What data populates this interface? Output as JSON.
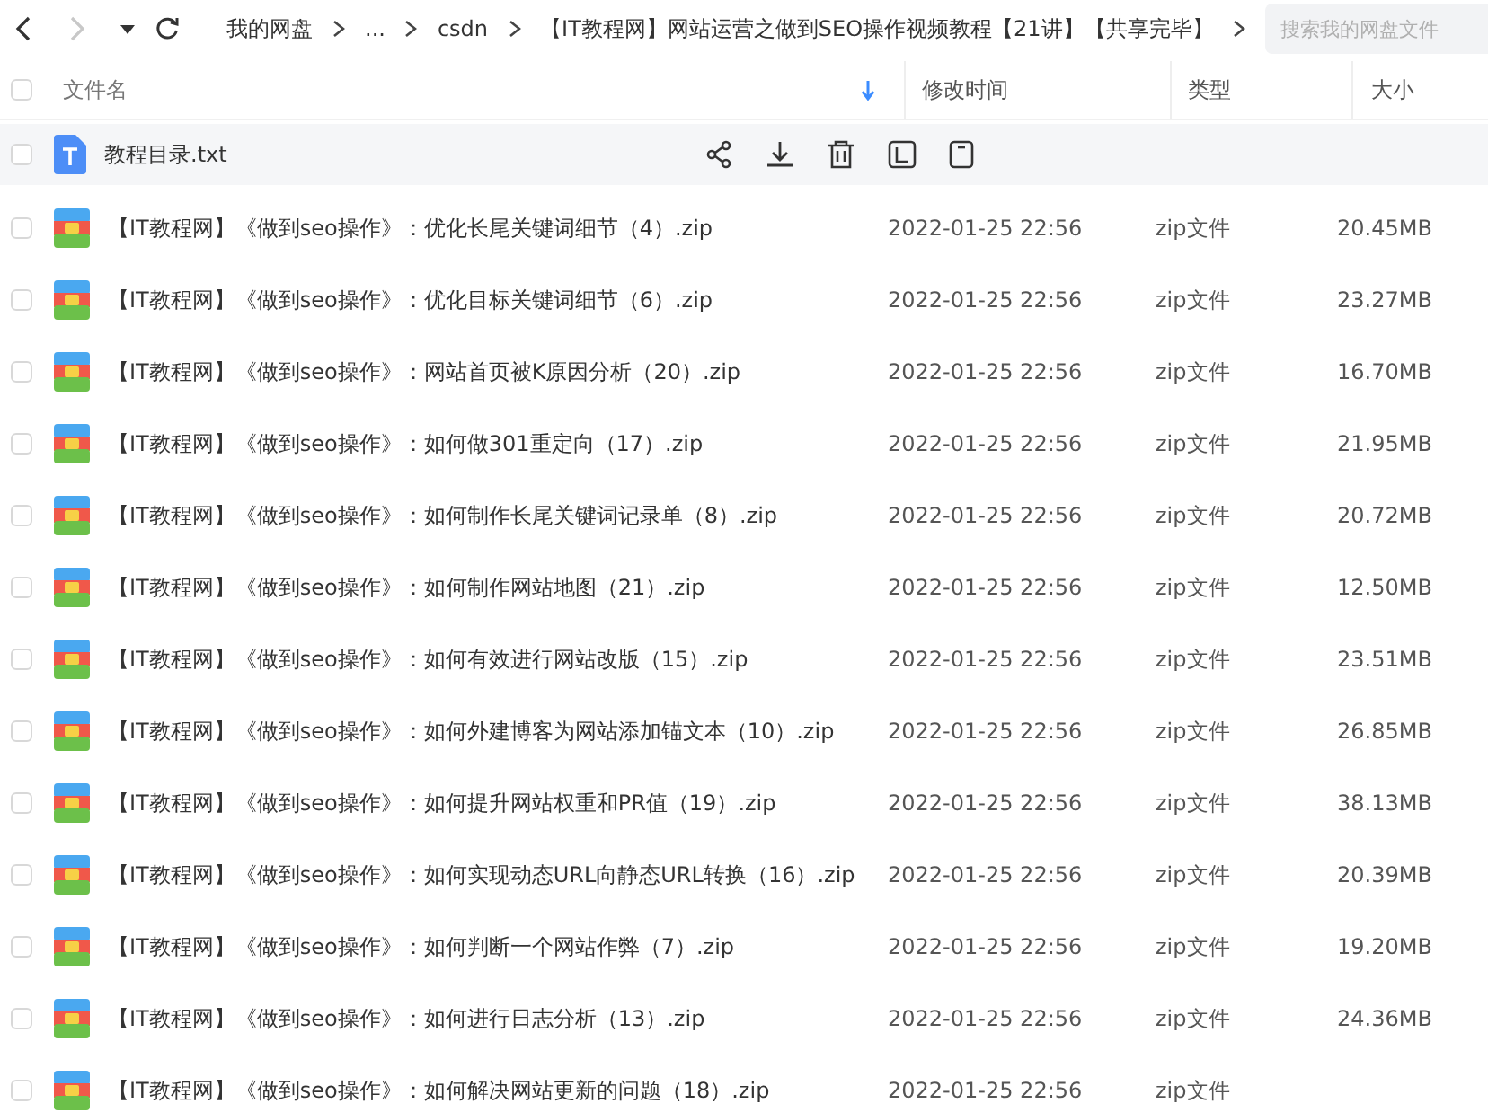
{
  "toolbar": {
    "breadcrumb": [
      {
        "label": "我的网盘"
      },
      {
        "label": "..."
      },
      {
        "label": "csdn"
      },
      {
        "label": "【IT教程网】网站运营之做到SEO操作视频教程【21讲】【共享完毕】"
      }
    ],
    "search": {
      "placeholder": "搜索我的网盘文件"
    }
  },
  "table": {
    "all_checked": false,
    "columns": [
      {
        "label": "文件名",
        "sorted": true
      },
      {
        "label": "修改时间",
        "sorted": false
      },
      {
        "label": "类型",
        "sorted": false
      },
      {
        "label": "大小",
        "sorted": false
      }
    ],
    "rows": [
      {
        "kind": "txt",
        "name": "教程目录.txt",
        "hovered": true,
        "checked": false
      },
      {
        "kind": "zip",
        "name": "【IT教程网】《做到seo操作》：优化长尾关键词细节（4）.zip",
        "modified": "2022-01-25 22:56",
        "type": "zip文件",
        "size": "20.45MB",
        "hovered": false,
        "checked": false
      },
      {
        "kind": "zip",
        "name": "【IT教程网】《做到seo操作》：优化目标关键词细节（6）.zip",
        "modified": "2022-01-25 22:56",
        "type": "zip文件",
        "size": "23.27MB",
        "hovered": false,
        "checked": false
      },
      {
        "kind": "zip",
        "name": "【IT教程网】《做到seo操作》：网站首页被K原因分析（20）.zip",
        "modified": "2022-01-25 22:56",
        "type": "zip文件",
        "size": "16.70MB",
        "hovered": false,
        "checked": false
      },
      {
        "kind": "zip",
        "name": "【IT教程网】《做到seo操作》：如何做301重定向（17）.zip",
        "modified": "2022-01-25 22:56",
        "type": "zip文件",
        "size": "21.95MB",
        "hovered": false,
        "checked": false
      },
      {
        "kind": "zip",
        "name": "【IT教程网】《做到seo操作》：如何制作长尾关键词记录单（8）.zip",
        "modified": "2022-01-25 22:56",
        "type": "zip文件",
        "size": "20.72MB",
        "hovered": false,
        "checked": false
      },
      {
        "kind": "zip",
        "name": "【IT教程网】《做到seo操作》：如何制作网站地图（21）.zip",
        "modified": "2022-01-25 22:56",
        "type": "zip文件",
        "size": "12.50MB",
        "hovered": false,
        "checked": false
      },
      {
        "kind": "zip",
        "name": "【IT教程网】《做到seo操作》：如何有效进行网站改版（15）.zip",
        "modified": "2022-01-25 22:56",
        "type": "zip文件",
        "size": "23.51MB",
        "hovered": false,
        "checked": false
      },
      {
        "kind": "zip",
        "name": "【IT教程网】《做到seo操作》：如何外建博客为网站添加锚文本（10）.zip",
        "modified": "2022-01-25 22:56",
        "type": "zip文件",
        "size": "26.85MB",
        "hovered": false,
        "checked": false
      },
      {
        "kind": "zip",
        "name": "【IT教程网】《做到seo操作》：如何提升网站权重和PR值（19）.zip",
        "modified": "2022-01-25 22:56",
        "type": "zip文件",
        "size": "38.13MB",
        "hovered": false,
        "checked": false
      },
      {
        "kind": "zip",
        "name": "【IT教程网】《做到seo操作》：如何实现动态URL向静态URL转换（16）.zip",
        "modified": "2022-01-25 22:56",
        "type": "zip文件",
        "size": "20.39MB",
        "hovered": false,
        "checked": false
      },
      {
        "kind": "zip",
        "name": "【IT教程网】《做到seo操作》：如何判断一个网站作弊（7）.zip",
        "modified": "2022-01-25 22:56",
        "type": "zip文件",
        "size": "19.20MB",
        "hovered": false,
        "checked": false
      },
      {
        "kind": "zip",
        "name": "【IT教程网】《做到seo操作》：如何进行日志分析（13）.zip",
        "modified": "2022-01-25 22:56",
        "type": "zip文件",
        "size": "24.36MB",
        "hovered": false,
        "checked": false
      },
      {
        "kind": "zip",
        "name": "【IT教程网】《做到seo操作》：如何解决网站更新的问题（18）.zip",
        "modified": "2022-01-25 22:56",
        "type": "zip文件",
        "hovered": false,
        "checked": false
      }
    ]
  }
}
